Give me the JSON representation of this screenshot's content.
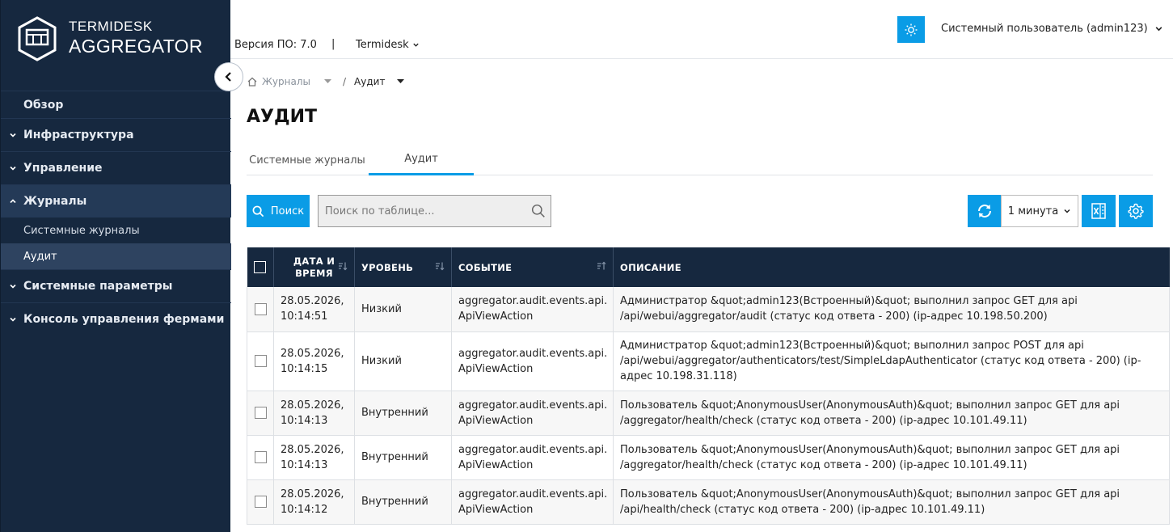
{
  "logo": {
    "line1": "TERMIDESK",
    "line2": "AGGREGATOR"
  },
  "sidebar": {
    "items": [
      {
        "label": "Обзор"
      },
      {
        "label": "Инфраструктура"
      },
      {
        "label": "Управление"
      },
      {
        "label": "Журналы"
      },
      {
        "label": "Системные параметры"
      },
      {
        "label": "Консоль управления фермами"
      }
    ],
    "sub_items": [
      {
        "label": "Системные журналы"
      },
      {
        "label": "Аудит"
      }
    ]
  },
  "topbar": {
    "version": "Версия ПО: 7.0",
    "separator": "|",
    "product": "Termidesk",
    "user": "Системный пользователь (admin123)"
  },
  "breadcrumb": {
    "parent": "Журналы",
    "separator": "/",
    "current": "Аудит"
  },
  "page": {
    "title": "АУДИТ"
  },
  "tabs": [
    {
      "label": "Системные журналы"
    },
    {
      "label": "Аудит"
    }
  ],
  "toolbar": {
    "search_button": "Поиск",
    "search_placeholder": "Поиск по таблице...",
    "interval": "1 минута"
  },
  "table": {
    "columns": [
      "ДАТА И ВРЕМЯ",
      "УРОВЕНЬ",
      "СОБЫТИЕ",
      "ОПИСАНИЕ"
    ],
    "date_header_line1": "ДАТА И",
    "date_header_line2": "ВРЕМЯ",
    "rows": [
      {
        "date": "28.05.2026,",
        "time": "10:14:51",
        "level": "Низкий",
        "event1": "aggregator.audit.events.api.",
        "event2": "ApiViewAction",
        "description": "Администратор &quot;admin123(Встроенный)&quot; выполнил запрос GET для api /api/webui/aggregator/audit (статус код ответа - 200) (ip-адрес 10.198.50.200)"
      },
      {
        "date": "28.05.2026,",
        "time": "10:14:15",
        "level": "Низкий",
        "event1": "aggregator.audit.events.api.",
        "event2": "ApiViewAction",
        "description": "Администратор &quot;admin123(Встроенный)&quot; выполнил запрос POST для api /api/webui/aggregator/authenticators/test/SimpleLdapAuthenticator (статус код ответа - 200) (ip-адрес 10.198.31.118)"
      },
      {
        "date": "28.05.2026,",
        "time": "10:14:13",
        "level": "Внутренний",
        "event1": "aggregator.audit.events.api.",
        "event2": "ApiViewAction",
        "description": "Пользователь &quot;AnonymousUser(AnonymousAuth)&quot; выполнил запрос GET для api /aggregator/health/check (статус код ответа - 200) (ip-адрес 10.101.49.11)"
      },
      {
        "date": "28.05.2026,",
        "time": "10:14:13",
        "level": "Внутренний",
        "event1": "aggregator.audit.events.api.",
        "event2": "ApiViewAction",
        "description": "Пользователь &quot;AnonymousUser(AnonymousAuth)&quot; выполнил запрос GET для api /aggregator/health/check (статус код ответа - 200) (ip-адрес 10.101.49.11)"
      },
      {
        "date": "28.05.2026,",
        "time": "10:14:12",
        "level": "Внутренний",
        "event1": "aggregator.audit.events.api.",
        "event2": "ApiViewAction",
        "description": "Пользователь &quot;AnonymousUser(AnonymousAuth)&quot; выполнил запрос GET для api /api/health/check (статус код ответа - 200) (ip-адрес 10.101.49.11)"
      }
    ]
  },
  "colors": {
    "sidebar_bg": "#16283f",
    "accent": "#0a9ce6",
    "table_header_bg": "#16283f"
  },
  "icons": [
    "logo-icon",
    "collapse-chevron-icon",
    "chevron-down-icon",
    "chevron-up-icon",
    "sun-icon",
    "home-icon",
    "caret-down-icon",
    "search-icon",
    "refresh-icon",
    "excel-icon",
    "gear-icon",
    "sort-icon"
  ]
}
